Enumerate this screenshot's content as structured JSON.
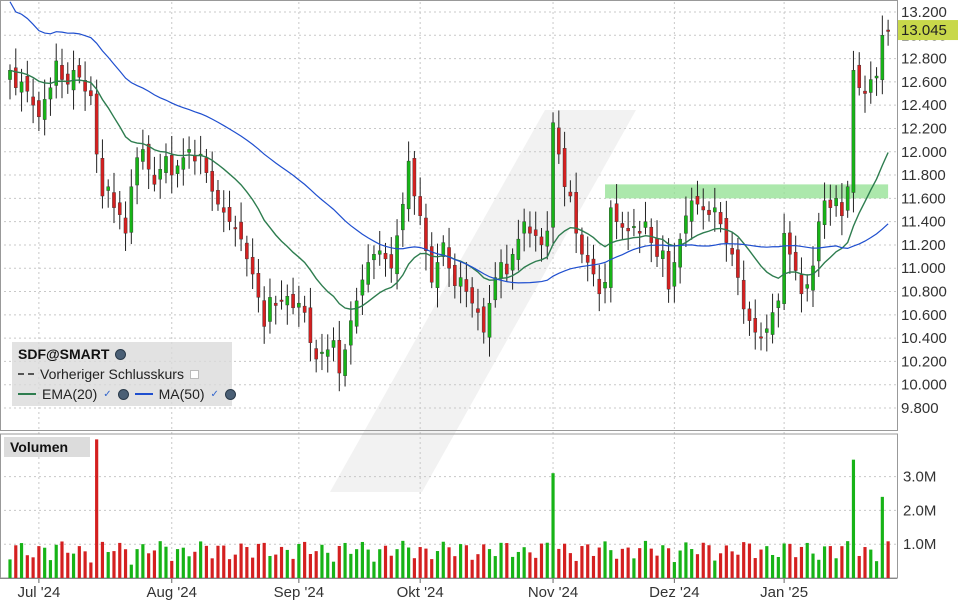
{
  "legend": {
    "symbol": "SDF@SMART",
    "prev_close": "Vorheriger Schlusskurs",
    "ema_label": "EMA(20)",
    "ma_label": "MA(50)",
    "check_mark": "✓"
  },
  "volume_panel": {
    "title": "Volumen"
  },
  "last_price_label": "13.045",
  "colors": {
    "up": "#17b317",
    "down": "#d42020",
    "ema": "#2e7d4f",
    "ma": "#1f4fcf",
    "resistance": "#90e090",
    "last_price_bg": "#c8d84a",
    "highlight_volume": "#f0f000"
  },
  "chart_data": [
    {
      "type": "candlestick",
      "title": "",
      "xlabel": "",
      "ylabel": "",
      "y_ticks": [
        "13.200",
        "13.000",
        "12.800",
        "12.600",
        "12.400",
        "12.200",
        "12.000",
        "11.800",
        "11.600",
        "11.400",
        "11.200",
        "11.000",
        "10.800",
        "10.600",
        "10.400",
        "10.200",
        "10.000",
        "9.800"
      ],
      "ylim": [
        9.8,
        13.2
      ],
      "x_ticks": [
        "Jul '24",
        "Aug '24",
        "Sep '24",
        "Okt '24",
        "Nov '24",
        "Dez '24",
        "Jan '25"
      ],
      "x_tick_dates": [
        "2024-07-01",
        "2024-08-01",
        "2024-09-02",
        "2024-10-01",
        "2024-11-01",
        "2024-12-02",
        "2025-01-02"
      ],
      "last_price": 13.045,
      "resistance_zone": {
        "from": "2024-11-14",
        "to": "2025-01-31",
        "low": 11.6,
        "high": 11.72
      },
      "closes": [
        {
          "date": "2024-06-24",
          "close": 12.7
        },
        {
          "date": "2024-06-25",
          "close": 12.55
        },
        {
          "date": "2024-06-26",
          "close": 12.6
        },
        {
          "date": "2024-06-27",
          "close": 12.52
        },
        {
          "date": "2024-06-28",
          "close": 12.4
        },
        {
          "date": "2024-07-01",
          "close": 12.3
        },
        {
          "date": "2024-07-02",
          "close": 12.45
        },
        {
          "date": "2024-07-03",
          "close": 12.55
        },
        {
          "date": "2024-07-04",
          "close": 12.78
        },
        {
          "date": "2024-07-05",
          "close": 12.62
        },
        {
          "date": "2024-07-08",
          "close": 12.58
        },
        {
          "date": "2024-07-09",
          "close": 12.7
        },
        {
          "date": "2024-07-10",
          "close": 12.64
        },
        {
          "date": "2024-07-11",
          "close": 12.52
        },
        {
          "date": "2024-07-12",
          "close": 12.48
        },
        {
          "date": "2024-07-15",
          "close": 11.98
        },
        {
          "date": "2024-07-16",
          "close": 11.62
        },
        {
          "date": "2024-07-17",
          "close": 11.7
        },
        {
          "date": "2024-07-18",
          "close": 11.52
        },
        {
          "date": "2024-07-19",
          "close": 11.46
        },
        {
          "date": "2024-07-22",
          "close": 11.3
        },
        {
          "date": "2024-07-23",
          "close": 11.7
        },
        {
          "date": "2024-07-24",
          "close": 11.95
        },
        {
          "date": "2024-07-25",
          "close": 12.02
        },
        {
          "date": "2024-07-26",
          "close": 11.85
        },
        {
          "date": "2024-07-29",
          "close": 11.72
        },
        {
          "date": "2024-07-30",
          "close": 11.85
        },
        {
          "date": "2024-07-31",
          "close": 11.96
        },
        {
          "date": "2024-08-01",
          "close": 11.8
        },
        {
          "date": "2024-08-02",
          "close": 11.88
        },
        {
          "date": "2024-08-05",
          "close": 11.95
        },
        {
          "date": "2024-08-06",
          "close": 12.02
        },
        {
          "date": "2024-08-07",
          "close": 11.92
        },
        {
          "date": "2024-08-08",
          "close": 11.98
        },
        {
          "date": "2024-08-09",
          "close": 11.82
        },
        {
          "date": "2024-08-12",
          "close": 11.66
        },
        {
          "date": "2024-08-13",
          "close": 11.55
        },
        {
          "date": "2024-08-14",
          "close": 11.48
        },
        {
          "date": "2024-08-15",
          "close": 11.4
        },
        {
          "date": "2024-08-16",
          "close": 11.35
        },
        {
          "date": "2024-08-19",
          "close": 11.25
        },
        {
          "date": "2024-08-20",
          "close": 11.08
        },
        {
          "date": "2024-08-21",
          "close": 10.95
        },
        {
          "date": "2024-08-22",
          "close": 10.75
        },
        {
          "date": "2024-08-23",
          "close": 10.5
        },
        {
          "date": "2024-08-26",
          "close": 10.75
        },
        {
          "date": "2024-08-27",
          "close": 10.68
        },
        {
          "date": "2024-08-28",
          "close": 10.72
        },
        {
          "date": "2024-08-29",
          "close": 10.76
        },
        {
          "date": "2024-08-30",
          "close": 10.66
        },
        {
          "date": "2024-09-02",
          "close": 10.7
        },
        {
          "date": "2024-09-03",
          "close": 10.62
        },
        {
          "date": "2024-09-04",
          "close": 10.36
        },
        {
          "date": "2024-09-05",
          "close": 10.22
        },
        {
          "date": "2024-09-06",
          "close": 10.28
        },
        {
          "date": "2024-09-09",
          "close": 10.3
        },
        {
          "date": "2024-09-10",
          "close": 10.38
        },
        {
          "date": "2024-09-11",
          "close": 10.1
        },
        {
          "date": "2024-09-12",
          "close": 10.3
        },
        {
          "date": "2024-09-13",
          "close": 10.55
        },
        {
          "date": "2024-09-16",
          "close": 10.72
        },
        {
          "date": "2024-09-17",
          "close": 10.9
        },
        {
          "date": "2024-09-18",
          "close": 11.05
        },
        {
          "date": "2024-09-19",
          "close": 11.12
        },
        {
          "date": "2024-09-20",
          "close": 11.15
        },
        {
          "date": "2024-09-23",
          "close": 11.08
        },
        {
          "date": "2024-09-24",
          "close": 11.0
        },
        {
          "date": "2024-09-25",
          "close": 11.28
        },
        {
          "date": "2024-09-26",
          "close": 11.55
        },
        {
          "date": "2024-09-27",
          "close": 11.92
        },
        {
          "date": "2024-09-30",
          "close": 11.62
        },
        {
          "date": "2024-10-01",
          "close": 11.45
        },
        {
          "date": "2024-10-02",
          "close": 11.15
        },
        {
          "date": "2024-10-03",
          "close": 10.88
        },
        {
          "date": "2024-10-04",
          "close": 11.05
        },
        {
          "date": "2024-10-07",
          "close": 11.22
        },
        {
          "date": "2024-10-08",
          "close": 11.0
        },
        {
          "date": "2024-10-09",
          "close": 10.85
        },
        {
          "date": "2024-10-10",
          "close": 10.92
        },
        {
          "date": "2024-10-11",
          "close": 10.8
        },
        {
          "date": "2024-10-14",
          "close": 10.7
        },
        {
          "date": "2024-10-15",
          "close": 10.62
        },
        {
          "date": "2024-10-16",
          "close": 10.45
        },
        {
          "date": "2024-10-17",
          "close": 10.7
        },
        {
          "date": "2024-10-18",
          "close": 10.92
        },
        {
          "date": "2024-10-21",
          "close": 11.05
        },
        {
          "date": "2024-10-22",
          "close": 10.95
        },
        {
          "date": "2024-10-23",
          "close": 11.12
        },
        {
          "date": "2024-10-24",
          "close": 11.25
        },
        {
          "date": "2024-10-25",
          "close": 11.4
        },
        {
          "date": "2024-10-28",
          "close": 11.3
        },
        {
          "date": "2024-10-29",
          "close": 11.28
        },
        {
          "date": "2024-10-30",
          "close": 11.2
        },
        {
          "date": "2024-10-31",
          "close": 11.32
        },
        {
          "date": "2024-11-01",
          "close": 12.25
        },
        {
          "date": "2024-11-04",
          "close": 11.98
        },
        {
          "date": "2024-11-05",
          "close": 11.7
        },
        {
          "date": "2024-11-06",
          "close": 11.62
        },
        {
          "date": "2024-11-07",
          "close": 11.3
        },
        {
          "date": "2024-11-08",
          "close": 11.12
        },
        {
          "date": "2024-11-11",
          "close": 11.05
        },
        {
          "date": "2024-11-12",
          "close": 10.95
        },
        {
          "date": "2024-11-13",
          "close": 10.78
        },
        {
          "date": "2024-11-14",
          "close": 10.88
        },
        {
          "date": "2024-11-15",
          "close": 11.52
        },
        {
          "date": "2024-11-18",
          "close": 11.4
        },
        {
          "date": "2024-11-19",
          "close": 11.35
        },
        {
          "date": "2024-11-20",
          "close": 11.32
        },
        {
          "date": "2024-11-21",
          "close": 11.36
        },
        {
          "date": "2024-11-22",
          "close": 11.3
        },
        {
          "date": "2024-11-25",
          "close": 11.4
        },
        {
          "date": "2024-11-26",
          "close": 11.22
        },
        {
          "date": "2024-11-27",
          "close": 11.1
        },
        {
          "date": "2024-11-28",
          "close": 11.15
        },
        {
          "date": "2024-11-29",
          "close": 10.82
        },
        {
          "date": "2024-12-02",
          "close": 11.05
        },
        {
          "date": "2024-12-03",
          "close": 11.25
        },
        {
          "date": "2024-12-04",
          "close": 11.45
        },
        {
          "date": "2024-12-05",
          "close": 11.58
        },
        {
          "date": "2024-12-06",
          "close": 11.55
        },
        {
          "date": "2024-12-09",
          "close": 11.5
        },
        {
          "date": "2024-12-10",
          "close": 11.46
        },
        {
          "date": "2024-12-11",
          "close": 11.52
        },
        {
          "date": "2024-12-12",
          "close": 11.38
        },
        {
          "date": "2024-12-13",
          "close": 11.22
        },
        {
          "date": "2024-12-16",
          "close": 11.12
        },
        {
          "date": "2024-12-17",
          "close": 10.92
        },
        {
          "date": "2024-12-18",
          "close": 10.65
        },
        {
          "date": "2024-12-19",
          "close": 10.55
        },
        {
          "date": "2024-12-20",
          "close": 10.45
        },
        {
          "date": "2024-12-23",
          "close": 10.4
        },
        {
          "date": "2024-12-27",
          "close": 10.48
        },
        {
          "date": "2024-12-30",
          "close": 10.62
        },
        {
          "date": "2024-12-31",
          "close": 10.72
        },
        {
          "date": "2025-01-02",
          "close": 11.3
        },
        {
          "date": "2025-01-03",
          "close": 11.12
        },
        {
          "date": "2025-01-06",
          "close": 10.98
        },
        {
          "date": "2025-01-07",
          "close": 10.78
        },
        {
          "date": "2025-01-08",
          "close": 10.86
        },
        {
          "date": "2025-01-09",
          "close": 11.02
        },
        {
          "date": "2025-01-10",
          "close": 11.4
        },
        {
          "date": "2025-01-13",
          "close": 11.58
        },
        {
          "date": "2025-01-14",
          "close": 11.52
        },
        {
          "date": "2025-01-15",
          "close": 11.6
        },
        {
          "date": "2025-01-16",
          "close": 11.45
        },
        {
          "date": "2025-01-17",
          "close": 11.7
        },
        {
          "date": "2025-01-20",
          "close": 12.7
        },
        {
          "date": "2025-01-21",
          "close": 12.55
        },
        {
          "date": "2025-01-22",
          "close": 12.5
        },
        {
          "date": "2025-01-23",
          "close": 12.62
        },
        {
          "date": "2025-01-24",
          "close": 12.65
        },
        {
          "date": "2025-01-27",
          "close": 13.0
        },
        {
          "date": "2025-01-28",
          "close": 13.045
        }
      ],
      "ema20_end": 11.88,
      "ma50_end": 11.35,
      "volume": {
        "y_ticks": [
          "3.0M",
          "2.0M",
          "1.0M"
        ],
        "ylim": [
          0,
          4.2
        ],
        "spikes": [
          {
            "date": "2024-07-15",
            "value": 4.1,
            "direction": "down"
          },
          {
            "date": "2024-11-01",
            "value": 3.1,
            "direction": "up"
          },
          {
            "date": "2025-01-20",
            "value": 3.5,
            "direction": "up"
          },
          {
            "date": "2025-01-27",
            "value": 2.4,
            "direction": "up"
          }
        ]
      }
    }
  ]
}
